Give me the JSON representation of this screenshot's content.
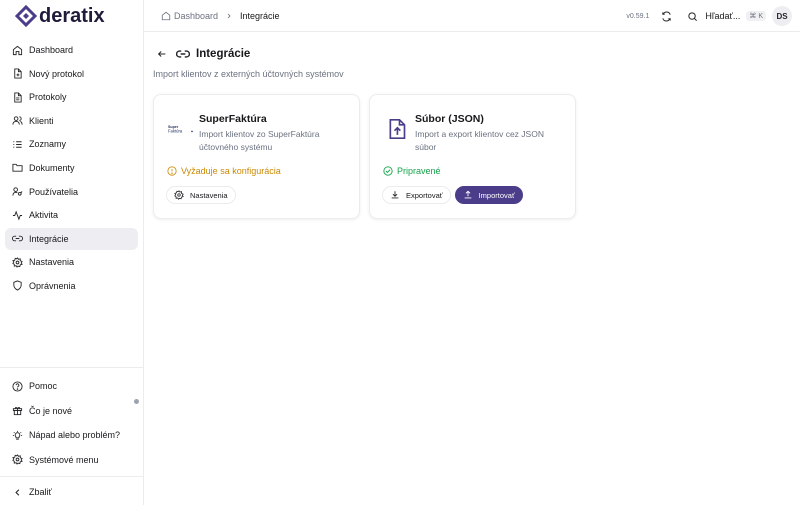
{
  "app": {
    "name": "deratix"
  },
  "breadcrumb": {
    "home": "Dashboard",
    "current": "Integrácie"
  },
  "topbar": {
    "version": "v0.59.1",
    "search_label": "Hľadať...",
    "search_shortcut": "⌘ K",
    "avatar_initials": "DS"
  },
  "sidebar": {
    "items": [
      {
        "label": "Dashboard",
        "icon": "home-icon"
      },
      {
        "label": "Nový protokol",
        "icon": "file-plus-icon"
      },
      {
        "label": "Protokoly",
        "icon": "file-text-icon"
      },
      {
        "label": "Klienti",
        "icon": "users-icon"
      },
      {
        "label": "Zoznamy",
        "icon": "list-icon"
      },
      {
        "label": "Dokumenty",
        "icon": "folder-icon"
      },
      {
        "label": "Používatelia",
        "icon": "user-key-icon"
      },
      {
        "label": "Aktivita",
        "icon": "activity-icon"
      },
      {
        "label": "Integrácie",
        "icon": "link-icon",
        "active": true
      },
      {
        "label": "Nastavenia",
        "icon": "gear-icon"
      },
      {
        "label": "Oprávnenia",
        "icon": "shield-icon"
      }
    ],
    "bottom": [
      {
        "label": "Pomoc",
        "icon": "help-icon"
      },
      {
        "label": "Čo je nové",
        "icon": "gift-icon"
      },
      {
        "label": "Nápad alebo problém?",
        "icon": "lightbulb-icon"
      },
      {
        "label": "Systémové menu",
        "icon": "gear-icon"
      }
    ],
    "collapse_label": "Zbaliť"
  },
  "page": {
    "title": "Integrácie",
    "subtitle": "Import klientov z externých účtovných systémov"
  },
  "cards": [
    {
      "name": "SuperFaktúra",
      "logo_text": "SuperFaktúra",
      "description": "Import klientov zo SuperFaktúra účtovného systému",
      "status": "Vyžaduje sa konfigurácia",
      "actions": [
        {
          "label": "Nastavenia"
        }
      ]
    },
    {
      "name": "Súbor (JSON)",
      "description": "Import a export klientov cez JSON súbor",
      "status": "Pripravené",
      "actions": [
        {
          "label": "Exportovať"
        },
        {
          "label": "Importovať"
        }
      ]
    }
  ],
  "colors": {
    "accent": "#4c3d8a",
    "warn": "#ca8a04",
    "ok": "#16a34a",
    "active_bg": "#eeedf2"
  }
}
